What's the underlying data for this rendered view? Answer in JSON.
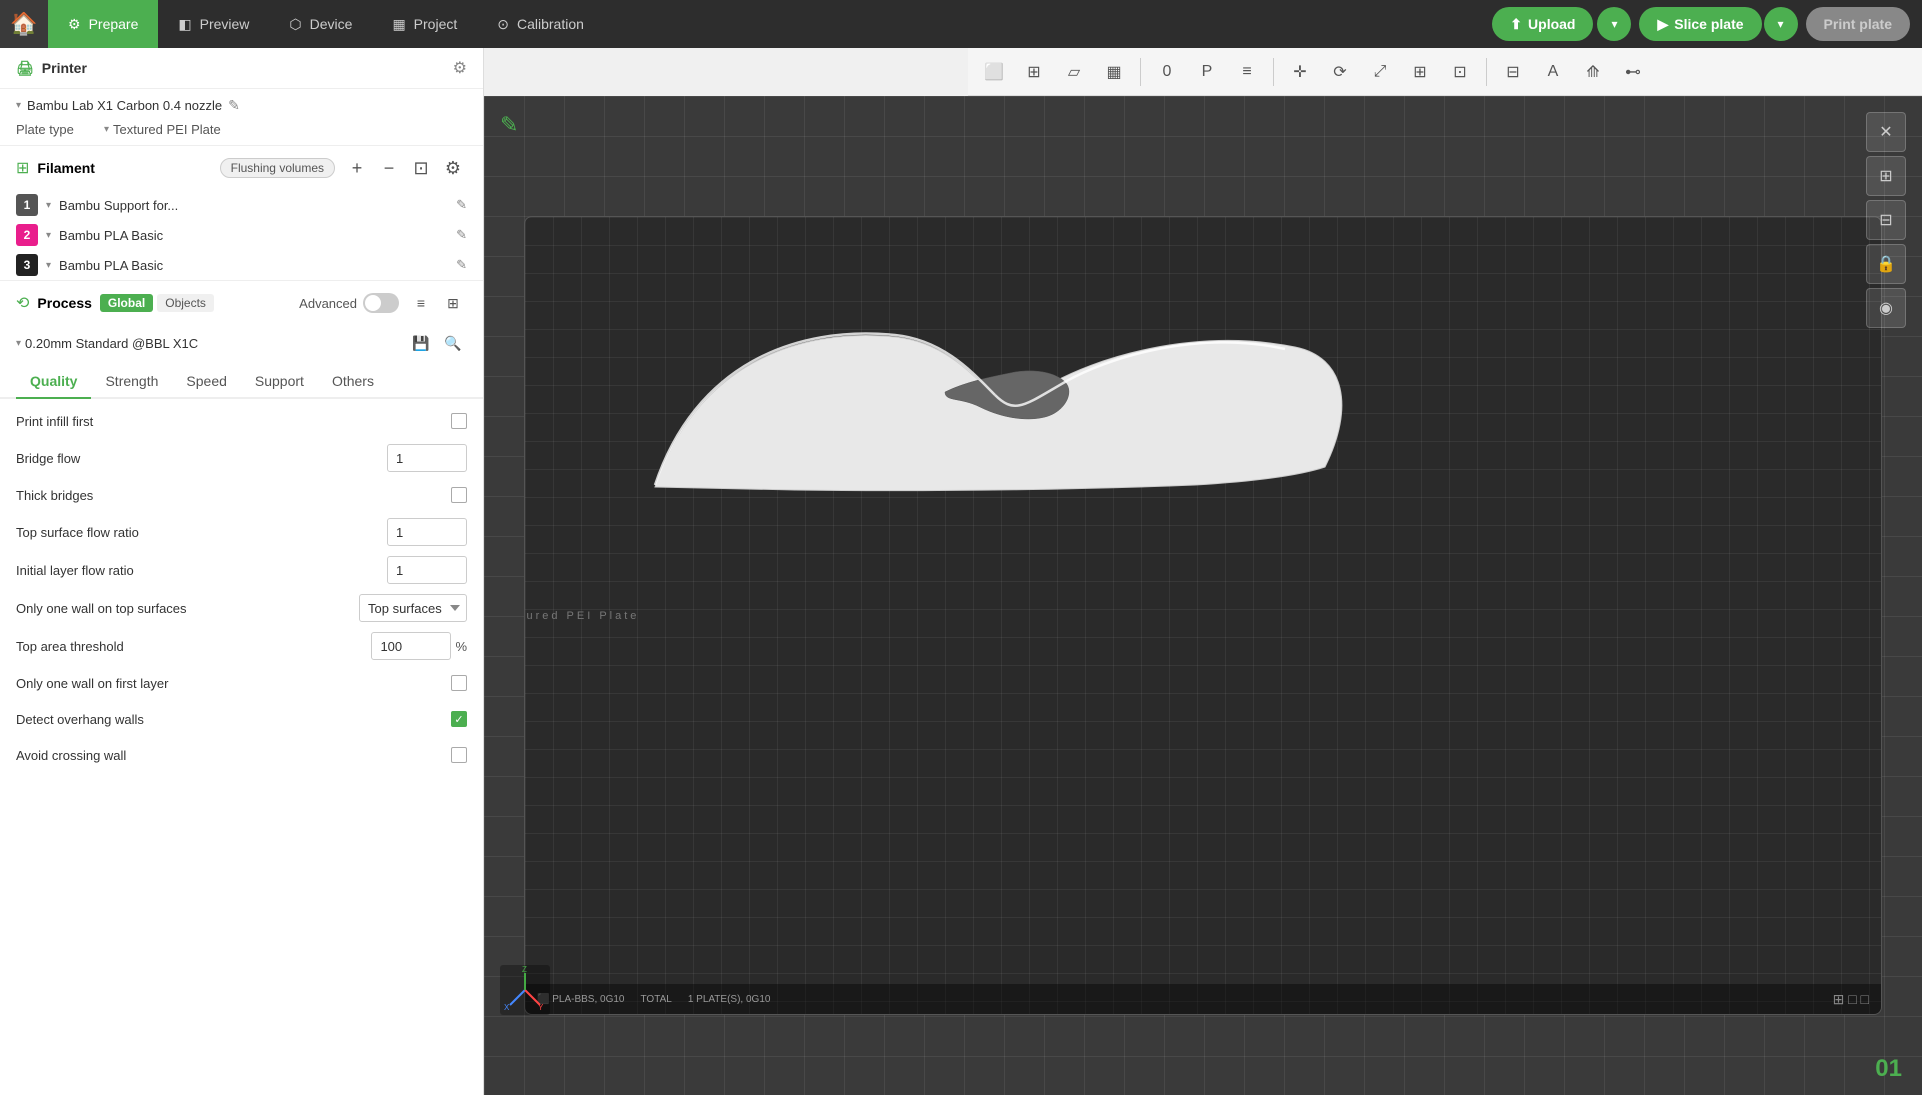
{
  "topnav": {
    "tabs": [
      {
        "id": "prepare",
        "label": "Prepare",
        "icon": "⚙",
        "active": true
      },
      {
        "id": "preview",
        "label": "Preview",
        "icon": "◧"
      },
      {
        "id": "device",
        "label": "Device",
        "icon": "□"
      },
      {
        "id": "project",
        "label": "Project",
        "icon": "▦"
      },
      {
        "id": "calibration",
        "label": "Calibration",
        "icon": "⊙"
      }
    ],
    "upload_label": "Upload",
    "slice_label": "Slice plate",
    "print_label": "Print plate"
  },
  "printer": {
    "section_label": "Printer",
    "name": "Bambu Lab X1 Carbon 0.4 nozzle",
    "plate_type_label": "Plate type",
    "plate_type_value": "Textured PEI Plate"
  },
  "filament": {
    "section_label": "Filament",
    "flushing_label": "Flushing volumes",
    "items": [
      {
        "num": "1",
        "name": "Bambu Support for...",
        "color": "#555"
      },
      {
        "num": "2",
        "name": "Bambu PLA Basic",
        "color": "#e91e8c"
      },
      {
        "num": "3",
        "name": "Bambu PLA Basic",
        "color": "#222"
      }
    ]
  },
  "process": {
    "section_label": "Process",
    "badge_global": "Global",
    "badge_objects": "Objects",
    "advanced_label": "Advanced",
    "preset_name": "0.20mm Standard @BBL X1C",
    "tabs": [
      {
        "id": "quality",
        "label": "Quality",
        "active": true
      },
      {
        "id": "strength",
        "label": "Strength"
      },
      {
        "id": "speed",
        "label": "Speed"
      },
      {
        "id": "support",
        "label": "Support"
      },
      {
        "id": "others",
        "label": "Others"
      }
    ],
    "settings": [
      {
        "id": "print-infill-first",
        "label": "Print infill first",
        "type": "checkbox",
        "checked": false
      },
      {
        "id": "bridge-flow",
        "label": "Bridge flow",
        "type": "input",
        "value": "1"
      },
      {
        "id": "thick-bridges",
        "label": "Thick bridges",
        "type": "checkbox",
        "checked": false
      },
      {
        "id": "top-surface-flow",
        "label": "Top surface flow ratio",
        "type": "input",
        "value": "1"
      },
      {
        "id": "initial-layer-flow",
        "label": "Initial layer flow ratio",
        "type": "input",
        "value": "1"
      },
      {
        "id": "only-one-wall-top",
        "label": "Only one wall on top surfaces",
        "type": "dropdown",
        "value": "Top surfaces"
      },
      {
        "id": "top-area-threshold",
        "label": "Top area threshold",
        "type": "input-unit",
        "value": "100",
        "unit": "%"
      },
      {
        "id": "only-one-wall-first",
        "label": "Only one wall on first layer",
        "type": "checkbox",
        "checked": false
      },
      {
        "id": "detect-overhang",
        "label": "Detect overhang walls",
        "type": "checkbox",
        "checked": true
      },
      {
        "id": "avoid-crossing",
        "label": "Avoid crossing wall",
        "type": "checkbox",
        "checked": false
      }
    ]
  },
  "viewport": {
    "edit_icon": "✎",
    "plate_number": "01",
    "status_items": [
      "PLA-BBS, 0E10",
      "TOTAL",
      "1 PLATE(S), 0E10"
    ]
  },
  "right_toolbar_buttons": [
    "✕",
    "⊞",
    "⊟",
    "🔒",
    "◉"
  ],
  "toolbar_icons": [
    "⬜",
    "⊞",
    "▱",
    "▦",
    "0",
    "P",
    "≡",
    "✛",
    "⌀",
    "□□",
    "□",
    "⊞",
    "⊞",
    "⊠",
    "⊟",
    "A",
    "⟰",
    "⊷"
  ]
}
